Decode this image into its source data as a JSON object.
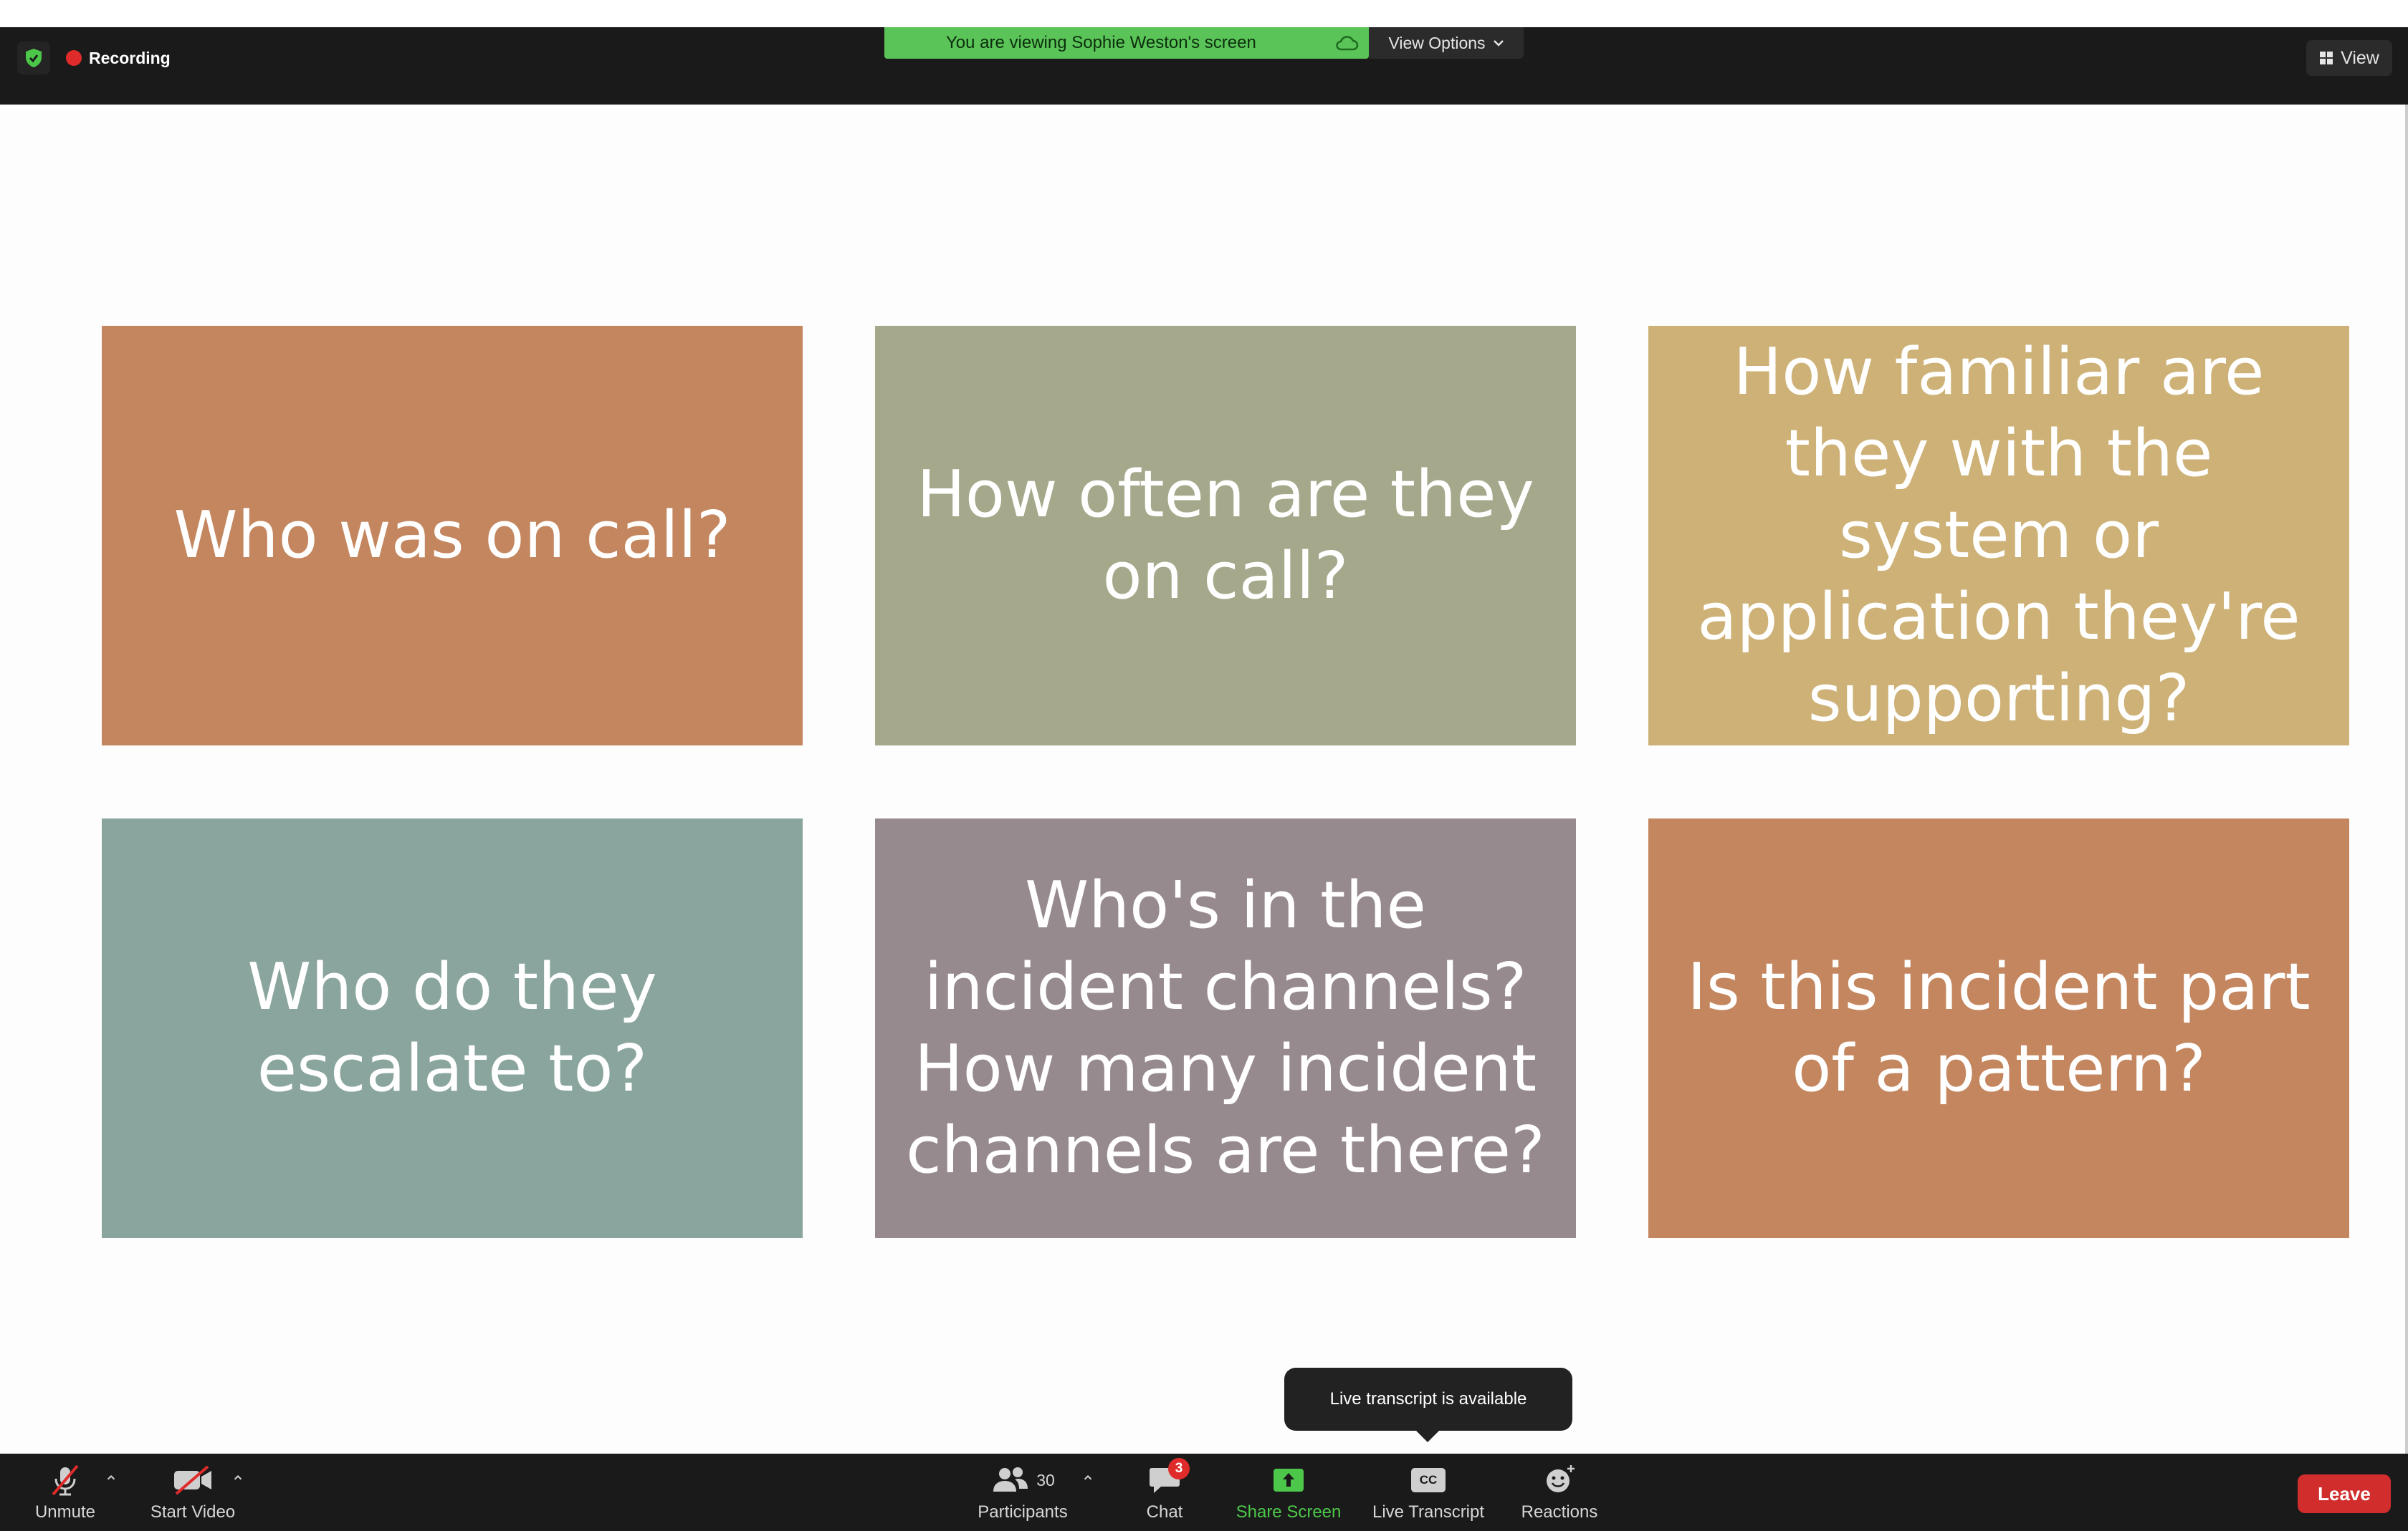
{
  "top_bar": {
    "recording_label": "Recording",
    "viewing_banner": "You are viewing Sophie Weston's screen",
    "view_options_label": "View Options",
    "view_label": "View",
    "recording_color": "#e02b2b",
    "banner_color": "#5ac458"
  },
  "slide": {
    "cards": [
      {
        "text": "Who was on call?",
        "color": "#c4865e"
      },
      {
        "text": "How often are they on call?",
        "color": "#a6a88b"
      },
      {
        "text": "How familiar are they with the system or application they're supporting?",
        "color": "#cdb176"
      },
      {
        "text": "Who do they escalate to?",
        "color": "#8aa59e"
      },
      {
        "text": "Who's in the incident channels? How many incident channels are there?",
        "color": "#978a8e"
      },
      {
        "text": "Is this incident part of a pattern?",
        "color": "#c4865e"
      }
    ]
  },
  "tooltip": {
    "text": "Live transcript is available"
  },
  "toolbar": {
    "unmute_label": "Unmute",
    "start_video_label": "Start Video",
    "participants_label": "Participants",
    "participants_count": "30",
    "chat_label": "Chat",
    "chat_badge": "3",
    "share_screen_label": "Share Screen",
    "live_transcript_label": "Live Transcript",
    "cc_text": "CC",
    "reactions_label": "Reactions",
    "leave_label": "Leave",
    "share_color": "#4cc74a",
    "leave_color": "#d12d2d"
  }
}
